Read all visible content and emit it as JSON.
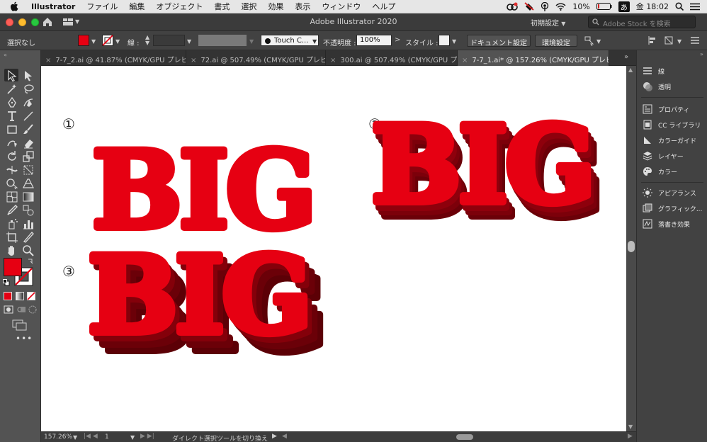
{
  "menubar": {
    "app": "Illustrator",
    "items": [
      "ファイル",
      "編集",
      "オブジェクト",
      "書式",
      "選択",
      "効果",
      "表示",
      "ウィンドウ",
      "ヘルプ"
    ],
    "battery": "10%",
    "ime": "あ",
    "clock": "金 18:02"
  },
  "window": {
    "title": "Adobe Illustrator 2020",
    "workspace": "初期設定",
    "stock_placeholder": "Adobe Stock を検索"
  },
  "control": {
    "selection": "選択なし",
    "fill_color": "#e60012",
    "stroke_label": "線 :",
    "brush": "Touch C...",
    "opacity_label": "不透明度 :",
    "opacity_value": "100%",
    "style_label": "スタイル :",
    "doc_setup": "ドキュメント設定",
    "prefs": "環境設定"
  },
  "tabs": [
    {
      "label": "7-7_2.ai @ 41.87% (CMYK/GPU プレビ..."
    },
    {
      "label": "72.ai @ 507.49% (CMYK/GPU プレビュ..."
    },
    {
      "label": "300.ai @ 507.49% (CMYK/GPU プレビ..."
    },
    {
      "label": "7-7_1.ai* @ 157.26% (CMYK/GPU プレビュー)"
    }
  ],
  "canvas": {
    "markers": [
      "①",
      "②",
      "③"
    ],
    "word": "BIG",
    "red": "#e60012",
    "shadow": "#6b0008"
  },
  "panels": [
    {
      "label": "線",
      "icon": "stroke-icon"
    },
    {
      "label": "透明",
      "icon": "transparency-icon"
    },
    {
      "label": "プロパティ",
      "icon": "properties-icon"
    },
    {
      "label": "CC ライブラリ",
      "icon": "libraries-icon"
    },
    {
      "label": "カラーガイド",
      "icon": "color-guide-icon"
    },
    {
      "label": "レイヤー",
      "icon": "layers-icon"
    },
    {
      "label": "カラー",
      "icon": "color-icon"
    },
    {
      "label": "アピアランス",
      "icon": "appearance-icon"
    },
    {
      "label": "グラフィック...",
      "icon": "graphic-styles-icon"
    },
    {
      "label": "落書き効果",
      "icon": "scribble-icon"
    }
  ],
  "status": {
    "zoom": "157.26%",
    "artboard": "1",
    "tool_hint": "ダイレクト選択ツールを切り換え"
  }
}
